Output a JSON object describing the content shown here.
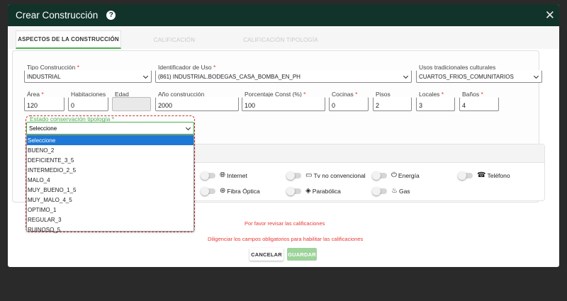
{
  "modal": {
    "title": "Crear Construcción",
    "help_icon": "question-circle-icon",
    "close_icon": "close-icon"
  },
  "tabs": [
    {
      "label": "ASPECTOS DE LA CONSTRUCCIÓN",
      "active": true
    },
    {
      "label": "CALIFICACIÓN",
      "active": false
    },
    {
      "label": "CALIFICACIÓN TIPOLOGÍA",
      "active": false
    }
  ],
  "form": {
    "tipo_construccion": {
      "label": "Tipo Construcción",
      "value": "INDUSTRIAL"
    },
    "identificador_uso": {
      "label": "Identificador de Uso",
      "value": "(861) INDUSTRIAL.BODEGAS_CASA_BOMBA_EN_PH"
    },
    "usos_tradicionales": {
      "label": "Usos tradicionales culturales",
      "value": "CUARTOS_FRIOS_COMUNITARIOS"
    },
    "area": {
      "label": "Área",
      "value": "120"
    },
    "habitaciones": {
      "label": "Habitaciones",
      "value": "0"
    },
    "edad": {
      "label": "Edad",
      "value": ""
    },
    "anio_construccion": {
      "label": "Año construcción",
      "value": "2000"
    },
    "porcentaje_const": {
      "label": "Porcentaje Const (%)",
      "value": "100"
    },
    "cocinas": {
      "label": "Cocinas",
      "value": "0"
    },
    "pisos": {
      "label": "Pisos",
      "value": "2"
    },
    "locales": {
      "label": "Locales",
      "value": "3"
    },
    "banos": {
      "label": "Baños",
      "value": "4"
    },
    "required_mark": "*",
    "estado_conservacion": {
      "label": "Estado conservación tipología",
      "value": "Seleccione",
      "options": [
        "Seleccione",
        "BUENO_2",
        "DEFICIENTE_3_5",
        "INTERMEDIO_2_5",
        "MALO_4",
        "MUY_BUENO_1_5",
        "MUY_MALO_4_5",
        "OPTIMO_1",
        "REGULAR_3",
        "RUINOSO_5"
      ]
    }
  },
  "services": [
    {
      "label": "Internet",
      "icon": "globe-icon"
    },
    {
      "label": "Tv no convencional",
      "icon": "tv-icon"
    },
    {
      "label": "Energía",
      "icon": "plug-icon"
    },
    {
      "label": "Teléfono",
      "icon": "phone-icon"
    },
    {
      "label": "Fibra Óptica",
      "icon": "fiber-icon"
    },
    {
      "label": "Parabólica",
      "icon": "satellite-dish-icon"
    },
    {
      "label": "Gas",
      "icon": "flame-icon"
    }
  ],
  "messages": {
    "revisar": "Por favor revisar las calificaciones",
    "diligenciar": "Diligenciar los campos obligatorios para habilitar las calificaciones"
  },
  "buttons": {
    "cancel": "CANCELAR",
    "save": "GUARDAR"
  },
  "colors": {
    "header_bg": "#12332a",
    "accent_green": "#4caf50",
    "error_red": "#e53935",
    "selected_option": "#1e78d6"
  }
}
